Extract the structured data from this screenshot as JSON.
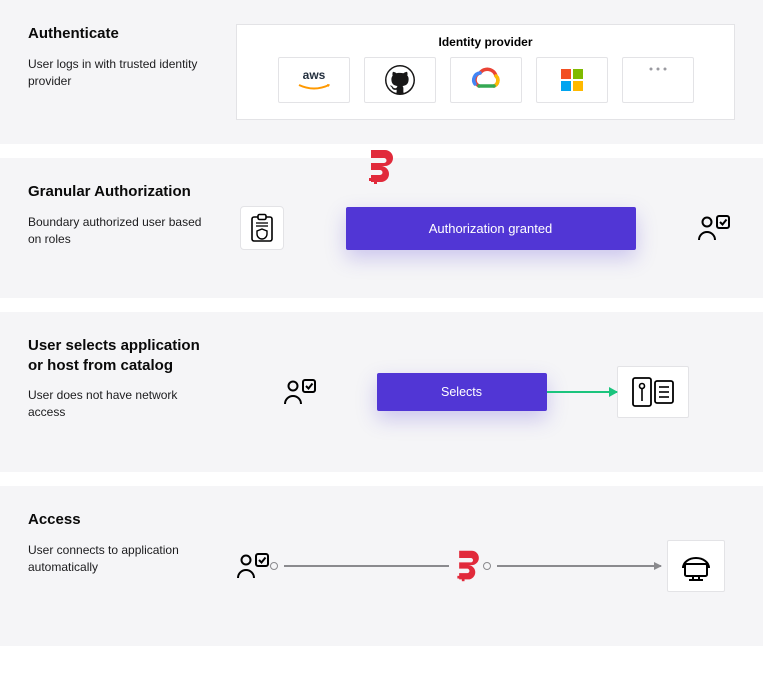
{
  "sections": {
    "authenticate": {
      "title": "Authenticate",
      "desc": "User logs in with trusted identity provider",
      "panel_title": "Identity provider",
      "providers": [
        "aws",
        "github",
        "google-cloud",
        "microsoft",
        "more"
      ]
    },
    "authorization": {
      "title": "Granular Authorization",
      "desc": "Boundary authorized user based on roles",
      "banner": "Authorization granted"
    },
    "selects": {
      "title": "User selects application or host from catalog",
      "desc": "User does not have network access",
      "banner": "Selects"
    },
    "access": {
      "title": "Access",
      "desc": "User connects to application automatically"
    }
  },
  "colors": {
    "purple": "#5136d5",
    "green": "#1bc47d",
    "red": "#e12a3b"
  }
}
